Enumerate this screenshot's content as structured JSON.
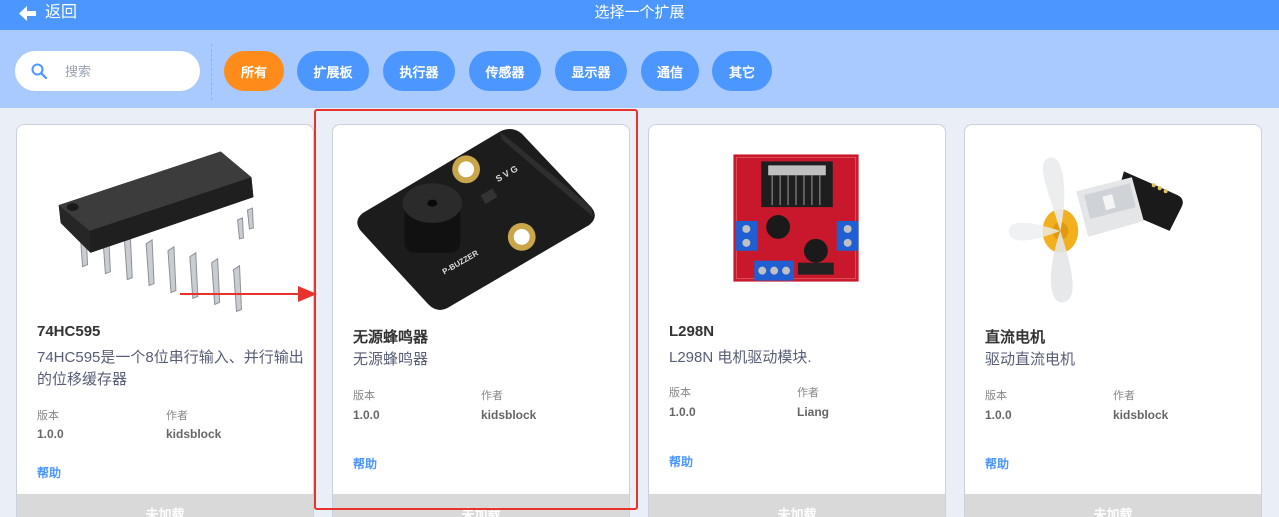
{
  "header": {
    "back_label": "返回",
    "title": "选择一个扩展"
  },
  "search": {
    "placeholder": "搜索"
  },
  "filters": [
    {
      "label": "所有",
      "active": true
    },
    {
      "label": "扩展板",
      "active": false
    },
    {
      "label": "执行器",
      "active": false
    },
    {
      "label": "传感器",
      "active": false
    },
    {
      "label": "显示器",
      "active": false
    },
    {
      "label": "通信",
      "active": false
    },
    {
      "label": "其它",
      "active": false
    }
  ],
  "extensions": [
    {
      "name": "74HC595",
      "description": "74HC595是一个8位串行输入、并行输出的位移缓存器",
      "version_label": "版本",
      "version": "1.0.0",
      "author_label": "作者",
      "author": "kidsblock",
      "help": "帮助",
      "status": "未加载"
    },
    {
      "name": "无源蜂鸣器",
      "description": "无源蜂鸣器",
      "version_label": "版本",
      "version": "1.0.0",
      "author_label": "作者",
      "author": "kidsblock",
      "help": "帮助",
      "status": "未加载",
      "image_text": {
        "pins": "S V G",
        "brand": "P-BUZZER"
      }
    },
    {
      "name": "L298N",
      "description": "L298N 电机驱动模块.",
      "version_label": "版本",
      "version": "1.0.0",
      "author_label": "作者",
      "author": "Liang",
      "help": "帮助",
      "status": "未加载"
    },
    {
      "name": "直流电机",
      "description": "驱动直流电机",
      "version_label": "版本",
      "version": "1.0.0",
      "author_label": "作者",
      "author": "kidsblock",
      "help": "帮助",
      "status": "未加载"
    }
  ],
  "colors": {
    "primary": "#4c97ff",
    "active_filter": "#ff8c1a",
    "highlight": "#e8332d",
    "filter_bar": "#a9caff"
  },
  "icons": {
    "back": "arrow-left-icon",
    "search": "search-icon"
  }
}
